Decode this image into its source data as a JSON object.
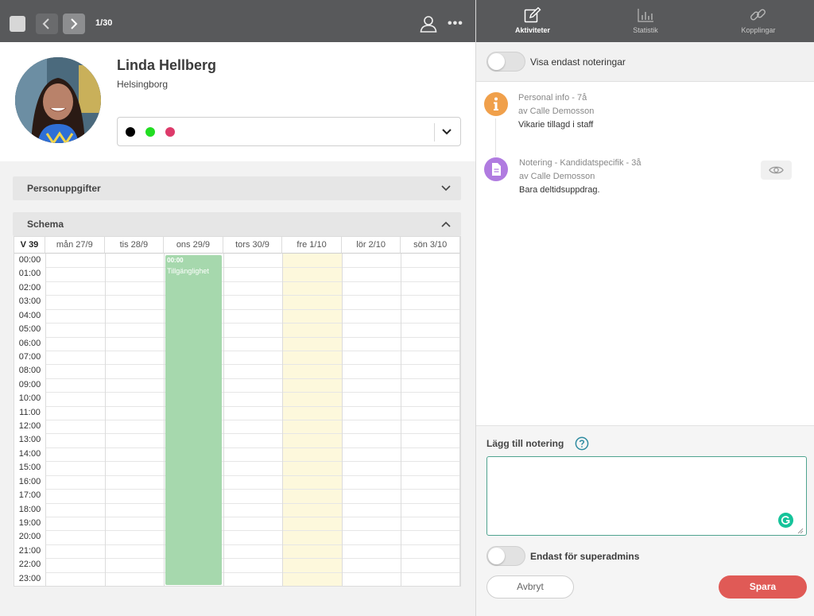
{
  "nav": {
    "counter": "1/30"
  },
  "profile": {
    "name": "Linda Hellberg",
    "city": "Helsingborg",
    "tags": [
      {
        "color": "#000000"
      },
      {
        "color": "#22dd22"
      },
      {
        "color": "#dd3a6a"
      }
    ]
  },
  "sections": {
    "personal": "Personuppgifter",
    "schedule": "Schema"
  },
  "schedule": {
    "week": "V 39",
    "days": [
      "mån 27/9",
      "tis 28/9",
      "ons 29/9",
      "tors 30/9",
      "fre 1/10",
      "lör 2/10",
      "sön 3/10"
    ],
    "hours": [
      "00:00",
      "01:00",
      "02:00",
      "03:00",
      "04:00",
      "05:00",
      "06:00",
      "07:00",
      "08:00",
      "09:00",
      "10:00",
      "11:00",
      "12:00",
      "13:00",
      "14:00",
      "15:00",
      "16:00",
      "17:00",
      "18:00",
      "19:00",
      "20:00",
      "21:00",
      "22:00",
      "23:00"
    ],
    "highlight_day_index": 4,
    "highlight_color": "#fdf8dc",
    "availability": {
      "day_index": 2,
      "start_label": "00:00",
      "label": "Tillgänglighet",
      "color": "#a6d8ad"
    }
  },
  "tabs": [
    {
      "label": "Aktiviteter",
      "icon": "edit-icon",
      "active": true
    },
    {
      "label": "Statistik",
      "icon": "bar-chart-icon",
      "active": false
    },
    {
      "label": "Kopplingar",
      "icon": "link-icon",
      "active": false
    }
  ],
  "filter": {
    "label": "Visa endast noteringar",
    "on": false
  },
  "activities": [
    {
      "icon": "info-icon",
      "color": "#f0a04b",
      "title": "Personal info - 7å",
      "author": "av Calle Demosson",
      "body": "Vikarie tillagd i staff"
    },
    {
      "icon": "document-icon",
      "color": "#b07be0",
      "title": "Notering - Kandidatspecifik - 3å",
      "author": "av Calle Demosson",
      "body": "Bara deltidsuppdrag."
    }
  ],
  "composer": {
    "label": "Lägg till notering",
    "value": "",
    "superadmin_label": "Endast för superadmins",
    "superadmin_on": false,
    "cancel_label": "Avbryt",
    "save_label": "Spara",
    "save_color": "#e05a56"
  }
}
